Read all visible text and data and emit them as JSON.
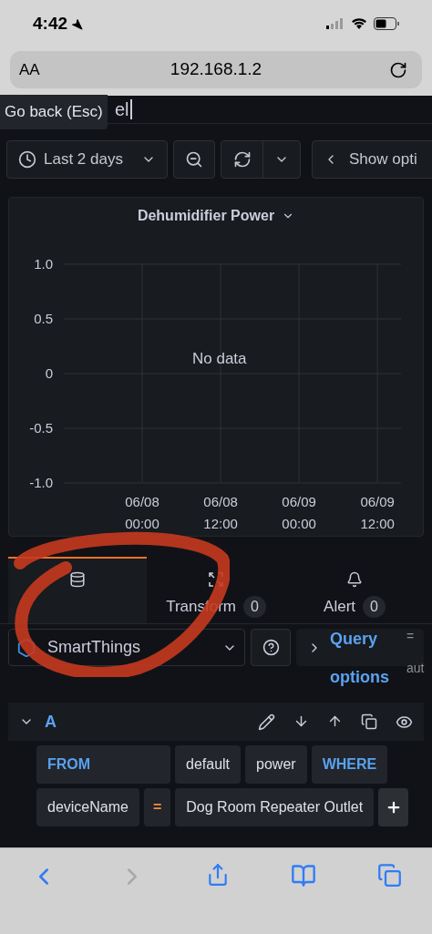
{
  "status_bar": {
    "time": "4:42"
  },
  "address_bar": {
    "text_size": "AA",
    "url": "192.168.1.2"
  },
  "title_field": {
    "visible_value": "el"
  },
  "tooltip": {
    "text": "Go back (Esc)"
  },
  "toolbar": {
    "time_range": "Last 2 days",
    "show_options": "Show opti"
  },
  "panel": {
    "chart_data": {
      "type": "line",
      "title": "Dehumidifier Power",
      "ylim": [
        -1,
        1
      ],
      "grid": true,
      "yticks": [
        {
          "value": 1,
          "label": "1.0"
        },
        {
          "value": 0.5,
          "label": "0.5"
        },
        {
          "value": 0,
          "label": "0"
        },
        {
          "value": -0.5,
          "label": "-0.5"
        },
        {
          "value": -1,
          "label": "-1.0"
        }
      ],
      "categories": [
        "06/08 00:00",
        "06/08 12:00",
        "06/09 00:00",
        "06/09 12:00"
      ],
      "annotations": [
        "No data"
      ]
    }
  },
  "tabs": [
    {
      "kind": "query",
      "selected": true
    },
    {
      "kind": "transform",
      "label": "Transform",
      "count": "0",
      "selected": false
    },
    {
      "kind": "alert",
      "label": "Alert",
      "count": "0",
      "selected": false
    }
  ],
  "datasource": {
    "name": "SmartThings",
    "query_options": "Query options",
    "side_1": "=",
    "side_2": "aut"
  },
  "query": {
    "letter": "A",
    "expanded": true,
    "from_clause": {
      "keyword": "FROM",
      "policy": "default",
      "measurement": "power",
      "where_keyword": "WHERE"
    },
    "condition": {
      "key": "deviceName",
      "operator": "=",
      "value": "Dog Room Repeater Outlet"
    }
  },
  "annotation": {
    "kind": "circle"
  }
}
